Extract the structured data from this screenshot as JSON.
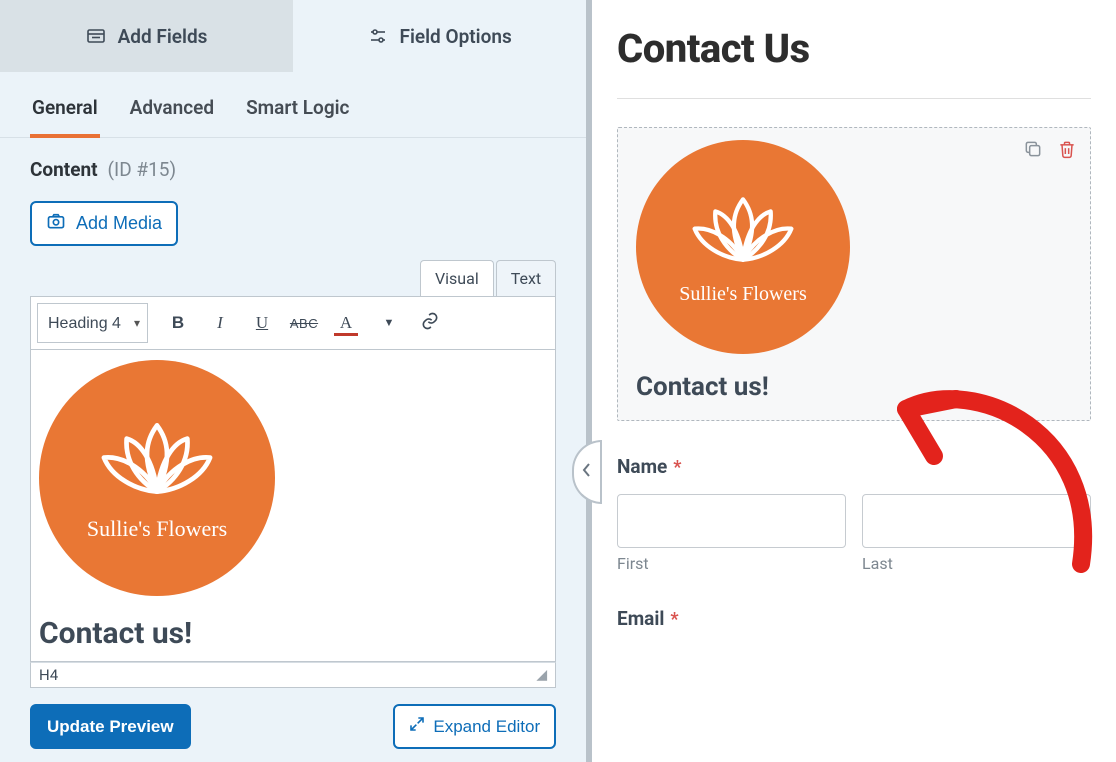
{
  "panel_tabs": {
    "add_fields": "Add Fields",
    "field_options": "Field Options"
  },
  "subtabs": {
    "general": "General",
    "advanced": "Advanced",
    "smart_logic": "Smart Logic"
  },
  "content_section": {
    "label": "Content",
    "id_text": "(ID #15)"
  },
  "buttons": {
    "add_media": "Add Media",
    "update_preview": "Update Preview",
    "expand_editor": "Expand Editor"
  },
  "editor": {
    "modes": {
      "visual": "Visual",
      "text": "Text"
    },
    "format_select": "Heading 4",
    "toolbar": {
      "bold": "B",
      "italic": "I",
      "underline": "U",
      "strike": "ABC",
      "text_color": "A"
    },
    "logo_text": "Sullie's Flowers",
    "body_heading": "Contact us!",
    "status_path": "H4"
  },
  "preview": {
    "title": "Contact Us",
    "logo_text": "Sullie's Flowers",
    "block_heading": "Contact us!",
    "name_label": "Name",
    "first_sublabel": "First",
    "last_sublabel": "Last",
    "email_label": "Email",
    "required_marker": "*"
  },
  "colors": {
    "accent": "#e97135",
    "primary": "#0d6db8",
    "logo_bg": "#e97734",
    "danger": "#d9534f"
  }
}
